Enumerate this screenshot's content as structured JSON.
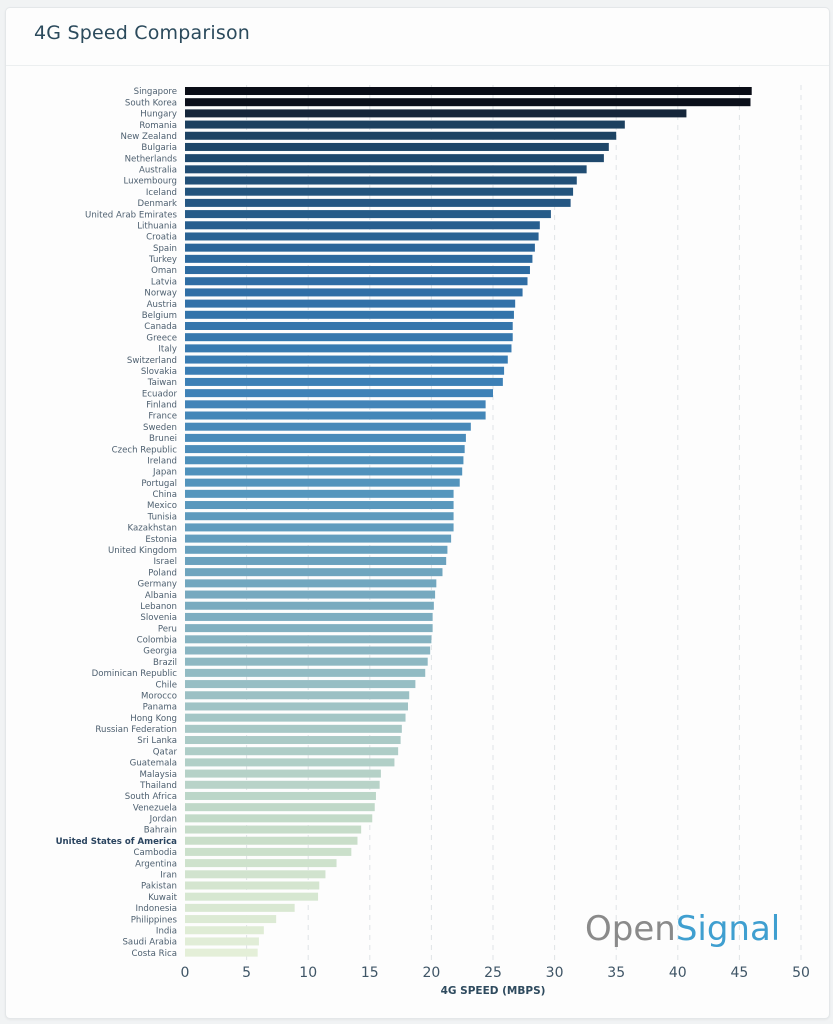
{
  "header": {
    "title": "4G Speed Comparison"
  },
  "logo": {
    "part1": "Open",
    "part2": "Signal",
    "color1": "#8a8a8a",
    "color2": "#3f9fd0"
  },
  "colors": {
    "gradient": [
      "#0a0d17",
      "#15263a",
      "#1e4668",
      "#2c6aa0",
      "#3c7fb6",
      "#5596bd",
      "#7aabbf",
      "#a5c7c6",
      "#c8dec9",
      "#e4efd8"
    ]
  },
  "chart_data": {
    "type": "bar",
    "orientation": "horizontal",
    "title": "4G Speed Comparison",
    "xlabel": "4G SPEED (MBPS)",
    "ylabel": "",
    "xlim": [
      0,
      50
    ],
    "xticks": [
      0,
      5,
      10,
      15,
      20,
      25,
      30,
      35,
      40,
      45,
      50
    ],
    "grid": "vertical dashed",
    "highlighted": "United States of America",
    "categories": [
      "Singapore",
      "South Korea",
      "Hungary",
      "Romania",
      "New Zealand",
      "Bulgaria",
      "Netherlands",
      "Australia",
      "Luxembourg",
      "Iceland",
      "Denmark",
      "United Arab Emirates",
      "Lithuania",
      "Croatia",
      "Spain",
      "Turkey",
      "Oman",
      "Latvia",
      "Norway",
      "Austria",
      "Belgium",
      "Canada",
      "Greece",
      "Italy",
      "Switzerland",
      "Slovakia",
      "Taiwan",
      "Ecuador",
      "Finland",
      "France",
      "Sweden",
      "Brunei",
      "Czech Republic",
      "Ireland",
      "Japan",
      "Portugal",
      "China",
      "Mexico",
      "Tunisia",
      "Kazakhstan",
      "Estonia",
      "United Kingdom",
      "Israel",
      "Poland",
      "Germany",
      "Albania",
      "Lebanon",
      "Slovenia",
      "Peru",
      "Colombia",
      "Georgia",
      "Brazil",
      "Dominican Republic",
      "Chile",
      "Morocco",
      "Panama",
      "Hong Kong",
      "Russian Federation",
      "Sri Lanka",
      "Qatar",
      "Guatemala",
      "Malaysia",
      "Thailand",
      "South Africa",
      "Venezuela",
      "Jordan",
      "Bahrain",
      "United States of America",
      "Cambodia",
      "Argentina",
      "Iran",
      "Pakistan",
      "Kuwait",
      "Indonesia",
      "Philippines",
      "India",
      "Saudi Arabia",
      "Costa Rica"
    ],
    "values": [
      46.0,
      45.9,
      40.7,
      35.7,
      35.0,
      34.4,
      34.0,
      32.6,
      31.8,
      31.5,
      31.3,
      29.7,
      28.8,
      28.7,
      28.4,
      28.2,
      28.0,
      27.8,
      27.4,
      26.8,
      26.7,
      26.6,
      26.6,
      26.5,
      26.2,
      25.9,
      25.8,
      25.0,
      24.4,
      24.4,
      23.2,
      22.8,
      22.7,
      22.6,
      22.5,
      22.3,
      21.8,
      21.8,
      21.8,
      21.8,
      21.6,
      21.3,
      21.2,
      20.9,
      20.4,
      20.3,
      20.2,
      20.1,
      20.1,
      20.0,
      19.9,
      19.7,
      19.5,
      18.7,
      18.2,
      18.1,
      17.9,
      17.6,
      17.5,
      17.3,
      17.0,
      15.9,
      15.8,
      15.5,
      15.4,
      15.2,
      14.3,
      14.0,
      13.5,
      12.3,
      11.4,
      10.9,
      10.8,
      8.9,
      7.4,
      6.4,
      6.0,
      5.9
    ]
  }
}
